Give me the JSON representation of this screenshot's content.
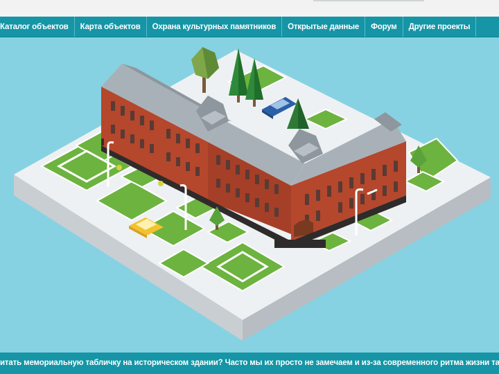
{
  "nav": {
    "items": [
      {
        "label": "Каталог объектов"
      },
      {
        "label": "Карта объектов"
      },
      {
        "label": "Охрана культурных памятников"
      },
      {
        "label": "Открытые данные"
      },
      {
        "label": "Форум"
      },
      {
        "label": "Другие проекты"
      }
    ]
  },
  "footer": {
    "ticker_text": "итать мемориальную табличку на историческом здании? Часто мы их просто не замечаем и из-за современного ритма жизни так и не удается"
  },
  "colors": {
    "nav_bg": "#1595a6",
    "hero_bg": "#86d2e2",
    "brick": "#b5472c",
    "roof": "#a9b1b8",
    "grass": "#6db33f"
  },
  "icons": [
    "building-illustration",
    "tree-icon",
    "car-icon",
    "street-lamp-icon"
  ]
}
